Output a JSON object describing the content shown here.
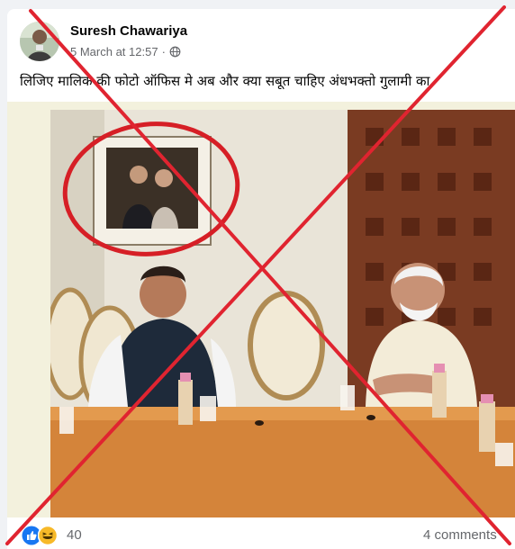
{
  "post": {
    "author": "Suresh Chawariya",
    "timestamp": "5 March at 12:57",
    "separator": "·",
    "audience_icon": "globe-icon",
    "caption": "लिजिए मालिक की फोटो ऑफिस मे अब और क्या सबूत चाहिए अंधभक्तो गुलामी का,",
    "image_alt": "Photo of a meeting in an office with a framed photograph circled in red on the wall"
  },
  "footer": {
    "reaction_icons": [
      "like-icon",
      "haha-icon"
    ],
    "reaction_count": "40",
    "comments_label": "4 comments"
  },
  "colors": {
    "fb_blue": "#1877f2",
    "haha_yellow": "#f7b928",
    "cross_red": "#e02430",
    "meta_gray": "#65676b"
  }
}
